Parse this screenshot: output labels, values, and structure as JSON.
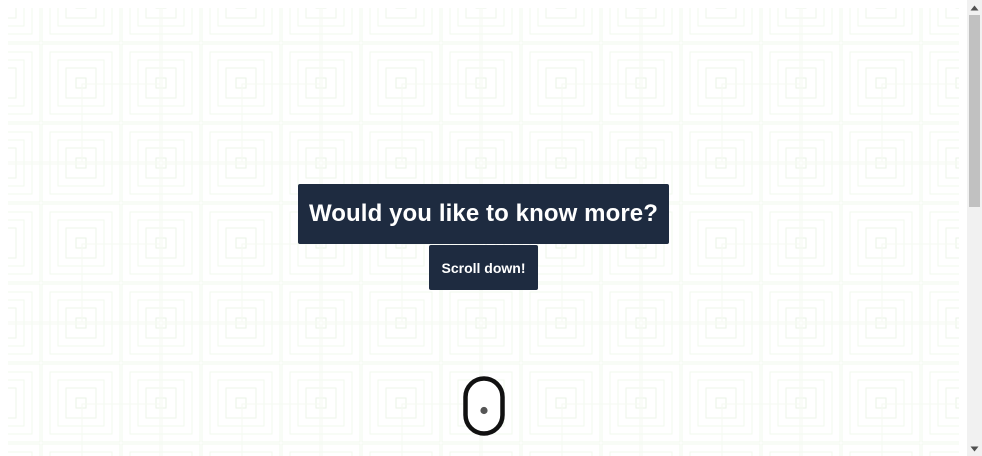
{
  "hero": {
    "title": "Would you like to know more?",
    "scroll_button_label": "Scroll down!"
  },
  "icons": {
    "scroll_indicator": "mouse-scroll-icon",
    "scrollbar_up": "triangle-up-icon",
    "scrollbar_down": "triangle-down-icon"
  },
  "colors": {
    "panel": "#1e2b40",
    "panel_text": "#ffffff",
    "pattern_stroke": "#eef7ea",
    "background": "#ffffff",
    "mouse_outline": "#111111",
    "mouse_wheel": "#555555"
  }
}
